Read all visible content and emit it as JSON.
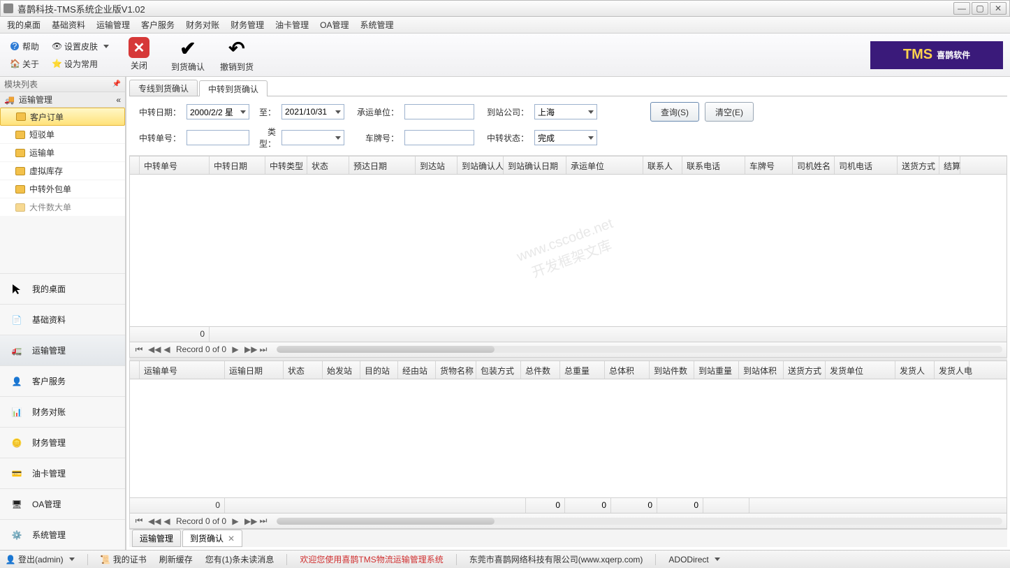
{
  "window": {
    "title": "喜鹊科技-TMS系统企业版V1.02"
  },
  "menubar": [
    "我的桌面",
    "基础资料",
    "运输管理",
    "客户服务",
    "财务对账",
    "财务管理",
    "油卡管理",
    "OA管理",
    "系统管理"
  ],
  "toolbar_small": {
    "help": "帮助",
    "skin": "设置皮肤",
    "about": "关于",
    "set_default": "设为常用"
  },
  "toolbar_big": {
    "close": "关闭",
    "confirm_arrival": "到货确认",
    "revoke_arrival": "撤销到货"
  },
  "brand": {
    "tms": "TMS",
    "name": "喜鹊软件"
  },
  "sidebar": {
    "title": "模块列表",
    "group": "运输管理",
    "tree": [
      "客户订单",
      "短驳单",
      "运输单",
      "虚拟库存",
      "中转外包单",
      "大件数大单"
    ],
    "tree_selected_index": 0,
    "nav": [
      "我的桌面",
      "基础资料",
      "运输管理",
      "客户服务",
      "财务对账",
      "财务管理",
      "油卡管理",
      "OA管理",
      "系统管理"
    ],
    "nav_active_index": 2
  },
  "tabs_top": [
    "专线到货确认",
    "中转到货确认"
  ],
  "tabs_top_active": 1,
  "filters": {
    "labels": {
      "transfer_date": "中转日期：",
      "to": "至：",
      "carrier": "承运单位：",
      "arrival_company": "到站公司：",
      "transfer_no": "中转单号：",
      "type": "类型：",
      "plate": "车牌号：",
      "transfer_status": "中转状态："
    },
    "values": {
      "date_from": "2000/2/2 星",
      "date_to": "2021/10/31",
      "arrival_company": "上海",
      "transfer_status": "完成"
    },
    "buttons": {
      "query": "查询(S)",
      "clear": "清空(E)"
    }
  },
  "grid1": {
    "columns": [
      "中转单号",
      "中转日期",
      "中转类型",
      "状态",
      "预达日期",
      "到达站",
      "到站确认人",
      "到站确认日期",
      "承运单位",
      "联系人",
      "联系电话",
      "车牌号",
      "司机姓名",
      "司机电话",
      "送货方式",
      "结算"
    ],
    "footer_first": "0",
    "nav_text": "Record 0 of 0"
  },
  "grid2": {
    "columns": [
      "运输单号",
      "运输日期",
      "状态",
      "始发站",
      "目的站",
      "经由站",
      "货物名称",
      "包装方式",
      "总件数",
      "总重量",
      "总体积",
      "到站件数",
      "到站重量",
      "到站体积",
      "送货方式",
      "发货单位",
      "发货人",
      "发货人电"
    ],
    "footer_first": "0",
    "sums": [
      "0",
      "0",
      "0",
      "0",
      "",
      ""
    ],
    "sums6off": [
      "",
      "",
      "",
      ""
    ],
    "nav_text": "Record 0 of 0"
  },
  "bottom_tabs": [
    "运输管理",
    "到货确认"
  ],
  "bottom_tabs_active": 1,
  "statusbar": {
    "logout": "登出(admin)",
    "my_cert": "我的证书",
    "refresh_cache": "刷新缓存",
    "unread": "您有(1)条未读消息",
    "welcome": "欢迎您使用喜鹊TMS物流运输管理系统",
    "company": "东莞市喜鹊网络科技有限公司(www.xqerp.com)",
    "db": "ADODirect"
  },
  "watermark": "www.cscode.net\n开发框架文库"
}
